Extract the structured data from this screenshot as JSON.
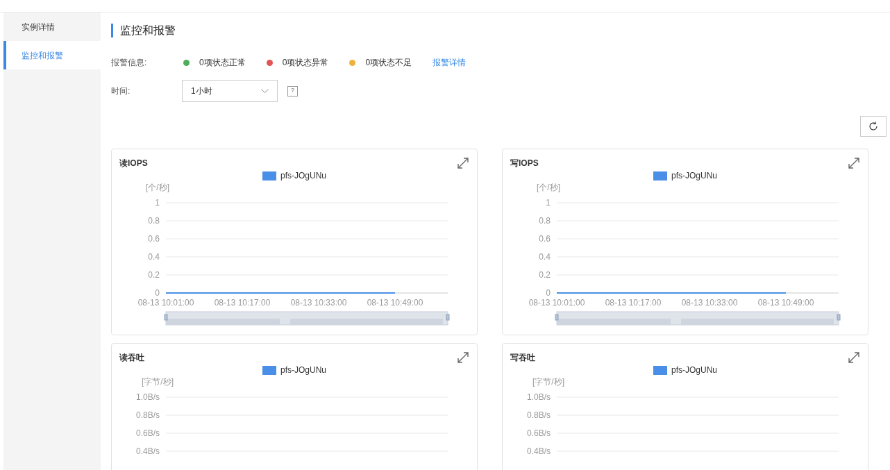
{
  "sidebar": {
    "items": [
      {
        "label": "实例详情",
        "selected": false
      },
      {
        "label": "监控和报警",
        "selected": true
      }
    ]
  },
  "page_title": "监控和报警",
  "alarm": {
    "label": "报警信息:",
    "statuses": [
      {
        "text": "0项状态正常",
        "color": "#4caf5b"
      },
      {
        "text": "0项状态异常",
        "color": "#e05454"
      },
      {
        "text": "0项状态不足",
        "color": "#eeb13c"
      }
    ],
    "link": "报警详情"
  },
  "time": {
    "label": "时间:",
    "value": "1小时",
    "help": "?"
  },
  "charts": [
    {
      "title": "读IOPS",
      "chart_data": {
        "type": "line",
        "ylabel": "[个/秒]",
        "grid": true,
        "x": [
          "08-13 10:01:00",
          "08-13 10:17:00",
          "08-13 10:33:00",
          "08-13 10:49:00"
        ],
        "yticks": [
          0,
          0.2,
          0.4,
          0.6,
          0.8,
          1
        ],
        "ylim": [
          0,
          1
        ],
        "series": [
          {
            "name": "pfs-JOgUNu",
            "color": "#4a8fe7",
            "values": [
              0,
              0,
              0,
              0
            ]
          }
        ]
      }
    },
    {
      "title": "写IOPS",
      "chart_data": {
        "type": "line",
        "ylabel": "[个/秒]",
        "grid": true,
        "x": [
          "08-13 10:01:00",
          "08-13 10:17:00",
          "08-13 10:33:00",
          "08-13 10:49:00"
        ],
        "yticks": [
          0,
          0.2,
          0.4,
          0.6,
          0.8,
          1
        ],
        "ylim": [
          0,
          1
        ],
        "series": [
          {
            "name": "pfs-JOgUNu",
            "color": "#4a8fe7",
            "values": [
              0,
              0,
              0,
              0
            ]
          }
        ]
      }
    },
    {
      "title": "读吞吐",
      "chart_data": {
        "type": "line",
        "ylabel": "[字节/秒]",
        "grid": true,
        "ylim": [
          0.4,
          1
        ],
        "yticks": [
          {
            "value": 1,
            "label": "1.0B/s"
          },
          {
            "value": 0.8,
            "label": "0.8B/s"
          },
          {
            "value": 0.6,
            "label": "0.6B/s"
          },
          {
            "value": 0.4,
            "label": "0.4B/s"
          }
        ],
        "series": [
          {
            "name": "pfs-JOgUNu",
            "color": "#4a8fe7"
          }
        ]
      }
    },
    {
      "title": "写吞吐",
      "chart_data": {
        "type": "line",
        "ylabel": "[字节/秒]",
        "grid": true,
        "ylim": [
          0.4,
          1
        ],
        "yticks": [
          {
            "value": 1,
            "label": "1.0B/s"
          },
          {
            "value": 0.8,
            "label": "0.8B/s"
          },
          {
            "value": 0.6,
            "label": "0.6B/s"
          },
          {
            "value": 0.4,
            "label": "0.4B/s"
          }
        ],
        "series": [
          {
            "name": "pfs-JOgUNu",
            "color": "#4a8fe7"
          }
        ]
      }
    }
  ]
}
